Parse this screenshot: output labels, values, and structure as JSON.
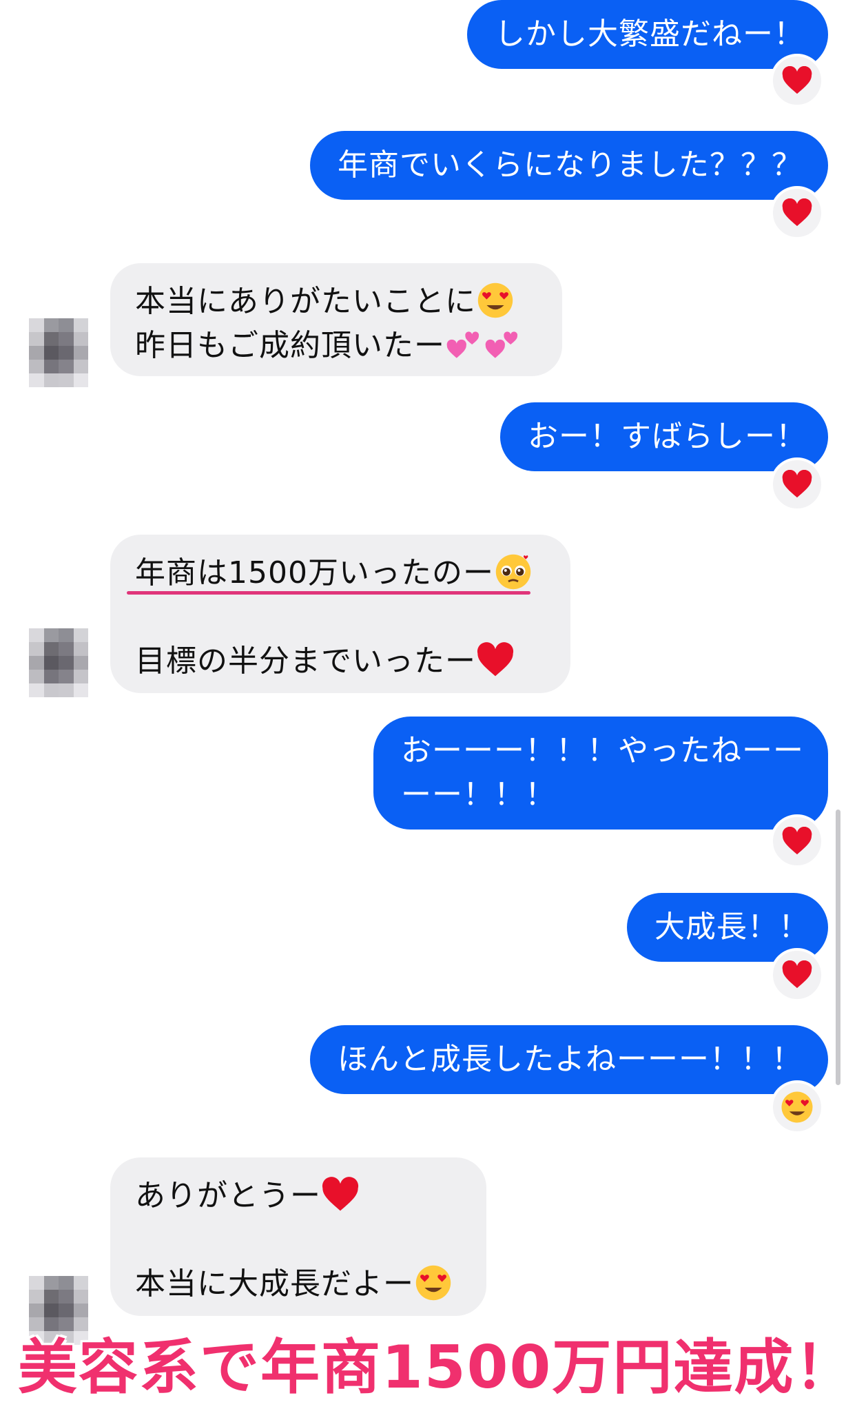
{
  "messages": [
    {
      "from": "me",
      "text": "しかし大繁盛だねー！",
      "reaction": "heart-icon"
    },
    {
      "from": "me",
      "text": "年商でいくらになりました？？？",
      "reaction": "heart-icon"
    },
    {
      "from": "them",
      "line1": "本当にありがたいことに",
      "line2": "昨日もご成約頂いたー"
    },
    {
      "from": "me",
      "text": "おー！すばらしー！",
      "reaction": "heart-icon"
    },
    {
      "from": "them",
      "line1": "年商は1500万いったのー",
      "line2": "目標の半分までいったー"
    },
    {
      "from": "me",
      "line1": "おーーー！！！やったねーー",
      "line2": "ーー！！！",
      "reaction": "heart-icon"
    },
    {
      "from": "me",
      "text": "大成長！！",
      "reaction": "heart-icon"
    },
    {
      "from": "me",
      "text": "ほんと成長したよねーーー！！！",
      "reaction": "heart-eyes-icon"
    },
    {
      "from": "them",
      "line1": "ありがとうー",
      "line2": "本当に大成長だよー"
    }
  ],
  "caption": "美容系で年商1500万円達成！",
  "colors": {
    "outgoing_bubble": "#0a60f4",
    "incoming_bubble": "#efeff1",
    "caption": "#f0306e",
    "underline": "#e0357a"
  }
}
